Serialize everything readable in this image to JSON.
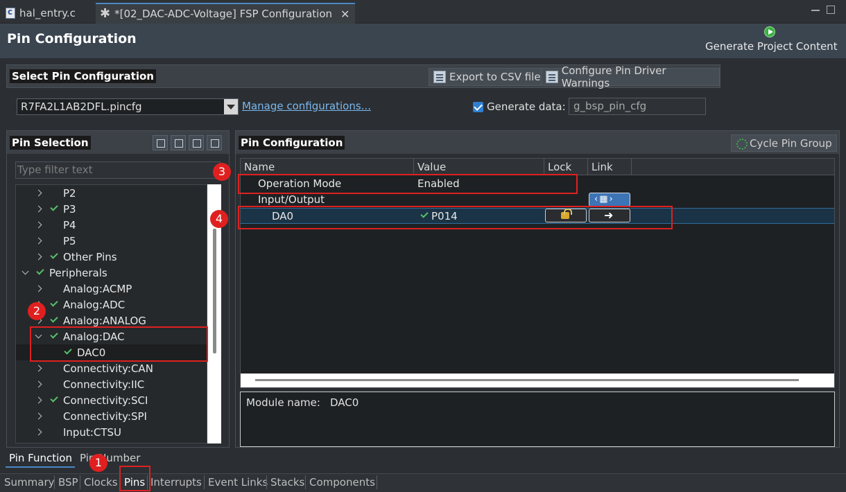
{
  "editor_tabs": [
    {
      "label": "hal_entry.c",
      "icon": "c-file-icon"
    },
    {
      "label": "*[02_DAC-ADC-Voltage] FSP Configuration",
      "icon": "gear-icon"
    }
  ],
  "header": {
    "title": "Pin Configuration",
    "generate_label": "Generate Project Content"
  },
  "select_section": {
    "title": "Select Pin Configuration",
    "export_label": "Export to CSV file",
    "configure_label": "Configure Pin Driver Warnings",
    "pincfg_value": "R7FA2L1AB2DFL.pincfg",
    "manage_link": "Manage configurations...",
    "generate_data_label": "Generate data:",
    "generate_data_value": "g_bsp_pin_cfg",
    "generate_data_checked": true
  },
  "pin_selection": {
    "title": "Pin Selection",
    "filter_placeholder": "Type filter text",
    "tree": [
      {
        "label": "P2",
        "level": 1,
        "expander": "right",
        "checked": false
      },
      {
        "label": "P3",
        "level": 1,
        "expander": "right",
        "checked": true
      },
      {
        "label": "P4",
        "level": 1,
        "expander": "right",
        "checked": false
      },
      {
        "label": "P5",
        "level": 1,
        "expander": "right",
        "checked": false
      },
      {
        "label": "Other Pins",
        "level": 1,
        "expander": "right",
        "checked": true
      },
      {
        "label": "Peripherals",
        "level": 0,
        "expander": "down",
        "checked": true
      },
      {
        "label": "Analog:ACMP",
        "level": 1,
        "expander": "right",
        "checked": false
      },
      {
        "label": "Analog:ADC",
        "level": 1,
        "expander": "right",
        "checked": true
      },
      {
        "label": "Analog:ANALOG",
        "level": 1,
        "expander": "right",
        "checked": true
      },
      {
        "label": "Analog:DAC",
        "level": 1,
        "expander": "down",
        "checked": true
      },
      {
        "label": "DAC0",
        "level": 2,
        "expander": "none",
        "checked": true,
        "selected": true
      },
      {
        "label": "Connectivity:CAN",
        "level": 1,
        "expander": "right",
        "checked": false
      },
      {
        "label": "Connectivity:IIC",
        "level": 1,
        "expander": "right",
        "checked": false
      },
      {
        "label": "Connectivity:SCI",
        "level": 1,
        "expander": "right",
        "checked": true
      },
      {
        "label": "Connectivity:SPI",
        "level": 1,
        "expander": "right",
        "checked": false
      },
      {
        "label": "Input:CTSU",
        "level": 1,
        "expander": "right",
        "checked": false
      }
    ]
  },
  "pin_config": {
    "title": "Pin Configuration",
    "cycle_label": "Cycle Pin Group",
    "columns": [
      "Name",
      "Value",
      "Lock",
      "Link"
    ],
    "rows": [
      {
        "name": "Operation Mode",
        "value": "Enabled"
      },
      {
        "name": "Input/Output",
        "value": ""
      },
      {
        "name": "DA0",
        "value": "P014"
      }
    ],
    "module_label": "Module name:",
    "module_value": "DAC0"
  },
  "sub_tabs": [
    "Pin Function",
    "Pin Number"
  ],
  "main_tabs": [
    "Summary",
    "BSP",
    "Clocks",
    "Pins",
    "Interrupts",
    "Event Links",
    "Stacks",
    "Components"
  ],
  "badges": [
    "1",
    "2",
    "3",
    "4"
  ],
  "colors": {
    "accent": "#4a88c7",
    "annotation": "#e02020",
    "check": "#56c26b"
  }
}
